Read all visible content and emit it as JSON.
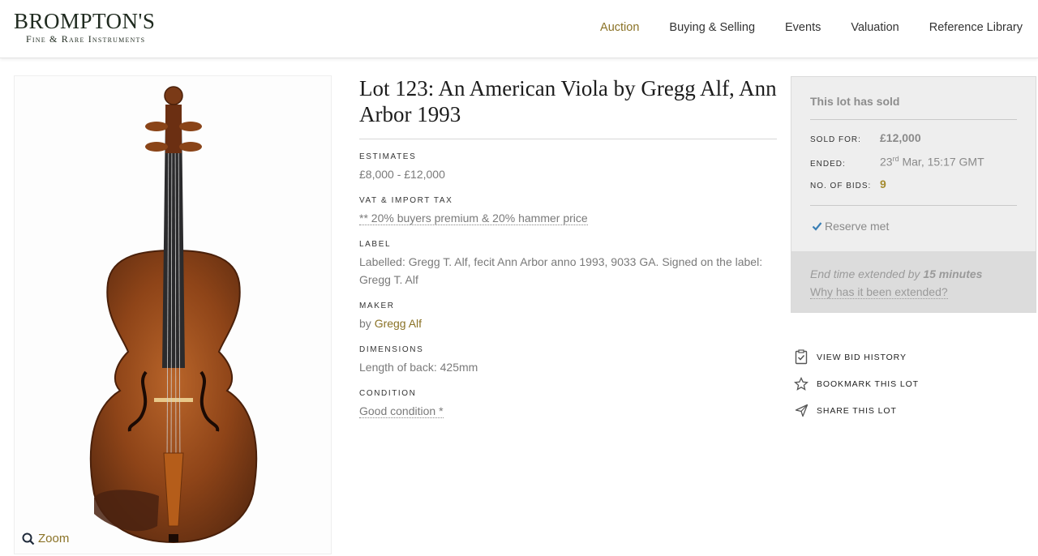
{
  "header": {
    "logo_main": "BROMPTON'S",
    "logo_sub": "Fine & Rare Instruments",
    "nav": [
      "Auction",
      "Buying & Selling",
      "Events",
      "Valuation",
      "Reference Library"
    ],
    "active_nav": "Auction"
  },
  "image": {
    "zoom_label": "Zoom"
  },
  "lot": {
    "title": "Lot 123: An American Viola by Gregg Alf, Ann Arbor 1993",
    "estimates_label": "ESTIMATES",
    "estimates_value": "£8,000 - £12,000",
    "vat_label": "VAT & IMPORT TAX",
    "vat_value": "** 20% buyers premium & 20% hammer price",
    "label_label": "LABEL",
    "label_value": "Labelled: Gregg T. Alf, fecit Ann Arbor anno 1993, 9033 GA. Signed on the label: Gregg T. Alf",
    "maker_label": "MAKER",
    "maker_prefix": "by",
    "maker_name": "Gregg Alf",
    "dimensions_label": "DIMENSIONS",
    "dimensions_value": "Length of back: 425mm",
    "condition_label": "CONDITION",
    "condition_value": "Good condition *"
  },
  "sold": {
    "heading": "This lot has sold",
    "sold_for_label": "SOLD FOR:",
    "sold_for_value": "£12,000",
    "ended_label": "ENDED:",
    "ended_day": "23",
    "ended_suffix": "rd",
    "ended_rest": "Mar, 15:17 GMT",
    "bids_label": "NO. OF BIDS:",
    "bids_value": "9",
    "reserve": "Reserve met",
    "ext_prefix": "End time extended by",
    "ext_amount": "15 minutes",
    "ext_link": "Why has it been extended?"
  },
  "actions": {
    "bid_history": "View Bid History",
    "bookmark": "Bookmark This Lot",
    "share": "Share This Lot"
  },
  "colors": {
    "accent": "#8a7226",
    "gold": "#a48a2e"
  }
}
